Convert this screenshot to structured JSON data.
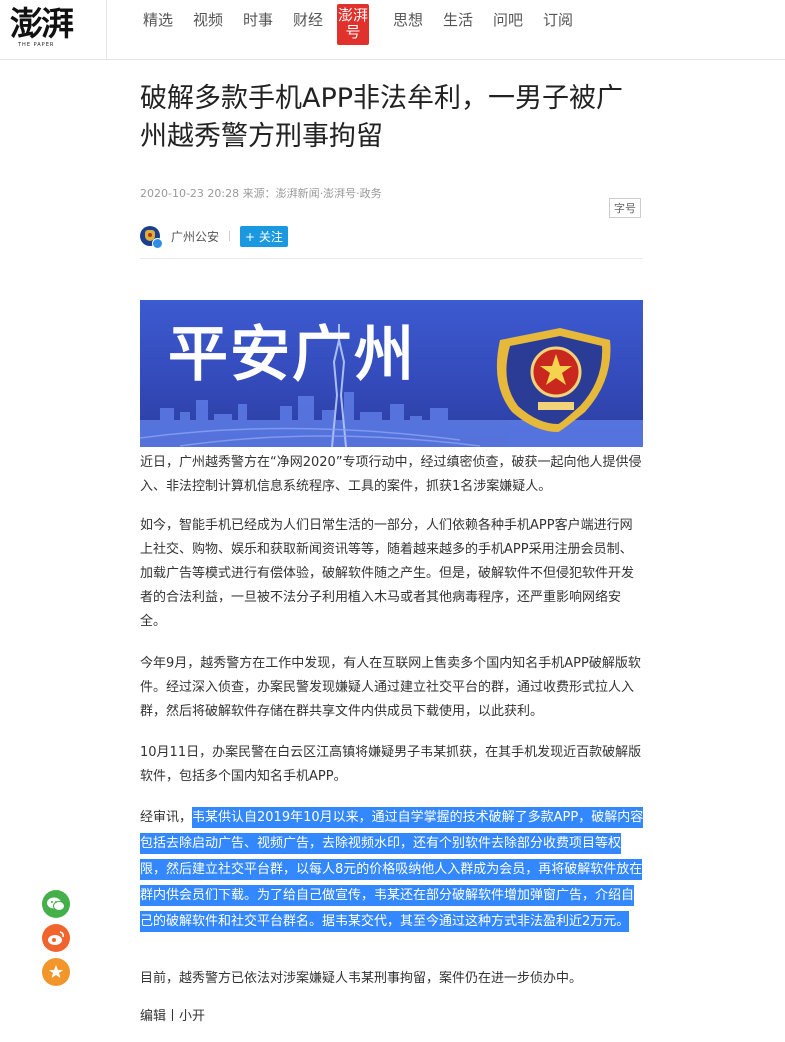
{
  "logo": {
    "cn": "澎湃",
    "en": "THE PAPER"
  },
  "nav": {
    "items": [
      {
        "label": "精选",
        "active": false
      },
      {
        "label": "视频",
        "active": false
      },
      {
        "label": "时事",
        "active": false
      },
      {
        "label": "财经",
        "active": false
      },
      {
        "label": "澎湃号",
        "active": true
      },
      {
        "label": "思想",
        "active": false
      },
      {
        "label": "生活",
        "active": false
      },
      {
        "label": "问吧",
        "active": false
      },
      {
        "label": "订阅",
        "active": false
      }
    ]
  },
  "article": {
    "title": "破解多款手机APP非法牟利，一男子被广州越秀警方刑事拘留",
    "meta": "2020-10-23 20:28 来源：澎湃新闻·澎湃号·政务",
    "font_size_label": "字号",
    "author": {
      "name": "广州公安",
      "follow_label": "+ 关注"
    },
    "banner": {
      "text": "平安广州"
    },
    "paragraphs": [
      "近日，广州越秀警方在“净网2020”专项行动中，经过缜密侦查，破获一起向他人提供侵入、非法控制计算机信息系统程序、工具的案件，抓获1名涉案嫌疑人。",
      "如今，智能手机已经成为人们日常生活的一部分，人们依赖各种手机APP客户端进行网上社交、购物、娱乐和获取新闻资讯等等，随着越来越多的手机APP采用注册会员制、加载广告等模式进行有偿体验，破解软件随之产生。但是，破解软件不但侵犯软件开发者的合法利益，一旦被不法分子利用植入木马或者其他病毒程序，还严重影响网络安全。",
      "今年9月，越秀警方在工作中发现，有人在互联网上售卖多个国内知名手机APP破解版软件。经过深入侦查，办案民警发现嫌疑人通过建立社交平台的群，通过收费形式拉人入群，然后将破解软件存储在群共享文件内供成员下载使用，以此获利。",
      "10月11日，办案民警在白云区江高镇将嫌疑男子韦某抓获，在其手机发现近百款破解版软件，包括多个国内知名手机APP。"
    ],
    "p5_prefix": "经审讯，",
    "p5_highlighted": "韦某供认自2019年10月以来，通过自学掌握的技术破解了多款APP，破解内容包括去除启动广告、视频广告，去除视频水印，还有个别软件去除部分收费项目等权限，然后建立社交平台群，以每人8元的价格吸纳他人入群成为会员，再将破解软件放在群内供会员们下载。为了给自己做宣传，韦某还在部分破解软件增加弹窗广告，介绍自己的破解软件和社交平台群名。据韦某交代，其至今通过这种方式非法盈利近2万元。",
    "p6": "目前，越秀警方已依法对涉案嫌疑人韦某刑事拘留，案件仍在进一步侦办中。",
    "editor": "编辑丨小开"
  },
  "share": {
    "icons": [
      "wechat-icon",
      "weibo-icon",
      "star-icon"
    ]
  },
  "colors": {
    "brand_red": "#e0312d",
    "follow_blue": "#1a99e0",
    "highlight_blue": "#3388ff",
    "banner_blue": "#3c5bd0"
  }
}
